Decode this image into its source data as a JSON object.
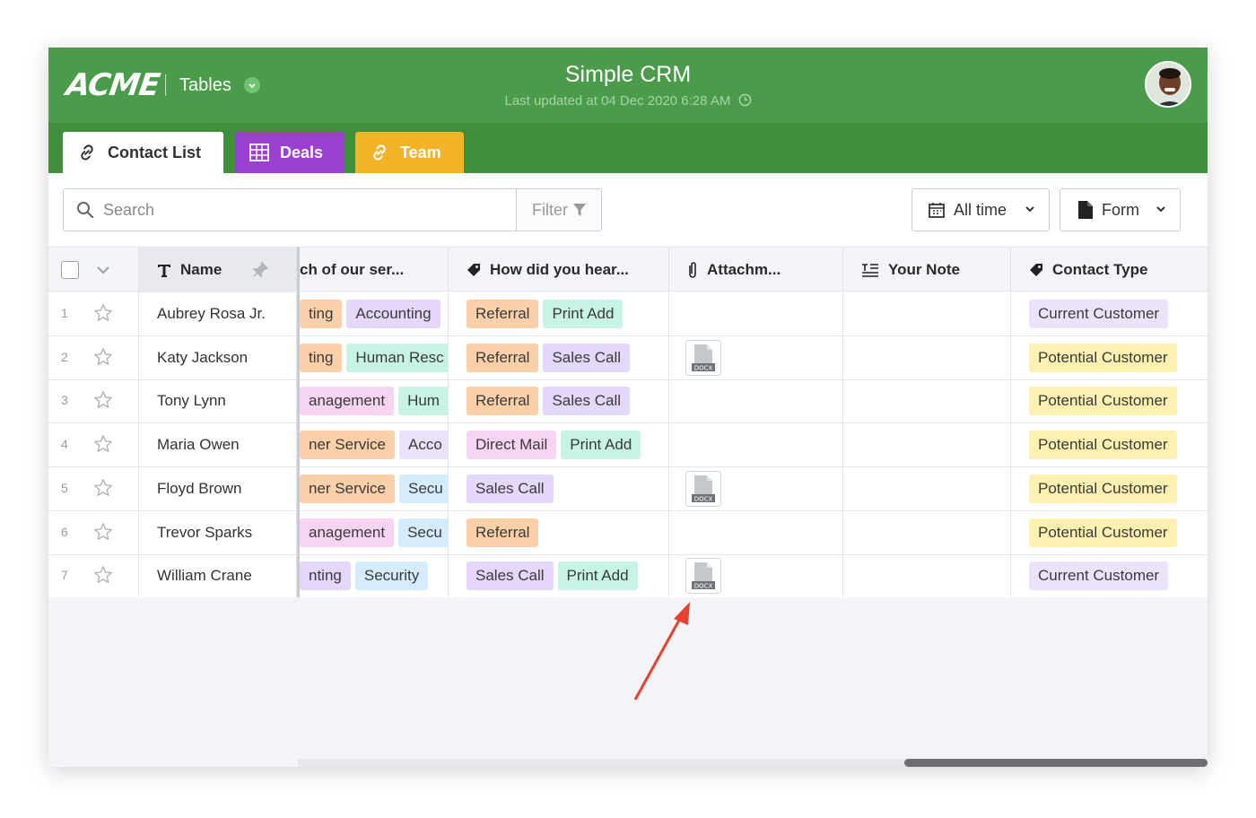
{
  "app": {
    "logo": "ACME",
    "section": "Tables",
    "title": "Simple CRM",
    "last_updated": "Last updated at 04 Dec 2020 6:28 AM"
  },
  "tabs": [
    {
      "label": "Contact List",
      "color": "#ffffff"
    },
    {
      "label": "Deals",
      "color": "#9a3fd0"
    },
    {
      "label": "Team",
      "color": "#f3b328"
    }
  ],
  "toolbar": {
    "search_placeholder": "Search",
    "filter_label": "Filter",
    "time_label": "All time",
    "form_label": "Form"
  },
  "columns": [
    {
      "label": "Name"
    },
    {
      "label": "ch of our ser..."
    },
    {
      "label": "How did you hear..."
    },
    {
      "label": "Attachm..."
    },
    {
      "label": "Your Note"
    },
    {
      "label": "Contact Type"
    }
  ],
  "rows": [
    {
      "num": "1",
      "name": "Aubrey Rosa Jr.",
      "services": [
        "ting",
        "Accounting"
      ],
      "heard": [
        "Referral",
        "Print Add"
      ],
      "attachment": false,
      "type": "Current Customer"
    },
    {
      "num": "2",
      "name": "Katy Jackson",
      "services": [
        "ting",
        "Human Resc"
      ],
      "heard": [
        "Referral",
        "Sales Call"
      ],
      "attachment": true,
      "type": "Potential Customer"
    },
    {
      "num": "3",
      "name": "Tony Lynn",
      "services": [
        "anagement",
        "Hum"
      ],
      "heard": [
        "Referral",
        "Sales Call"
      ],
      "attachment": false,
      "type": "Potential Customer"
    },
    {
      "num": "4",
      "name": "Maria Owen",
      "services": [
        "ner Service",
        "Acco"
      ],
      "heard": [
        "Direct Mail",
        "Print Add"
      ],
      "attachment": false,
      "type": "Potential Customer"
    },
    {
      "num": "5",
      "name": "Floyd Brown",
      "services": [
        "ner Service",
        "Secu"
      ],
      "heard": [
        "Sales Call"
      ],
      "attachment": true,
      "type": "Potential Customer"
    },
    {
      "num": "6",
      "name": "Trevor Sparks",
      "services": [
        "anagement",
        "Secu"
      ],
      "heard": [
        "Referral"
      ],
      "attachment": false,
      "type": "Potential Customer"
    },
    {
      "num": "7",
      "name": "William Crane",
      "services": [
        "nting",
        "Security"
      ],
      "heard": [
        "Sales Call",
        "Print Add"
      ],
      "attachment": true,
      "type": "Current Customer"
    }
  ],
  "attachment_label": "DOCX",
  "colors": {
    "topbar": "#4a9b4a",
    "tabbar": "#3f8f3c",
    "arrow": "#e8402f"
  }
}
